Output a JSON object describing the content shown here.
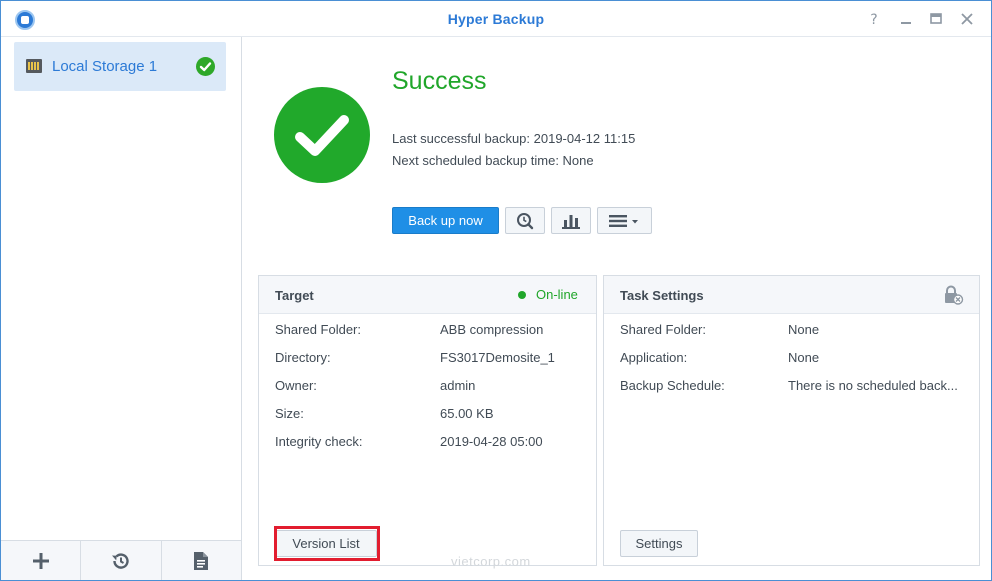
{
  "window": {
    "title": "Hyper Backup"
  },
  "sidebar": {
    "items": [
      {
        "label": "Local Storage 1",
        "status": "success"
      }
    ]
  },
  "status": {
    "title": "Success",
    "last_backup": "Last successful backup: 2019-04-12 11:15",
    "next_backup": "Next scheduled backup time: None"
  },
  "actions": {
    "backup_now": "Back up now"
  },
  "target": {
    "title": "Target",
    "status": "On-line",
    "rows": [
      {
        "label": "Shared Folder:",
        "value": "ABB compression"
      },
      {
        "label": "Directory:",
        "value": "FS3017Demosite_1"
      },
      {
        "label": "Owner:",
        "value": "admin"
      },
      {
        "label": "Size:",
        "value": "65.00 KB"
      },
      {
        "label": "Integrity check:",
        "value": "2019-04-28 05:00"
      }
    ],
    "button": "Version List"
  },
  "task_settings": {
    "title": "Task Settings",
    "rows": [
      {
        "label": "Shared Folder:",
        "value": "None"
      },
      {
        "label": "Application:",
        "value": "None"
      },
      {
        "label": "Backup Schedule:",
        "value": "There is no scheduled back..."
      }
    ],
    "button": "Settings"
  },
  "watermark": "vietcorp.com",
  "colors": {
    "accent": "#2c7ad6",
    "success": "#21a92b",
    "primary_button": "#1f8fe6",
    "highlight": "#e21d2f"
  }
}
